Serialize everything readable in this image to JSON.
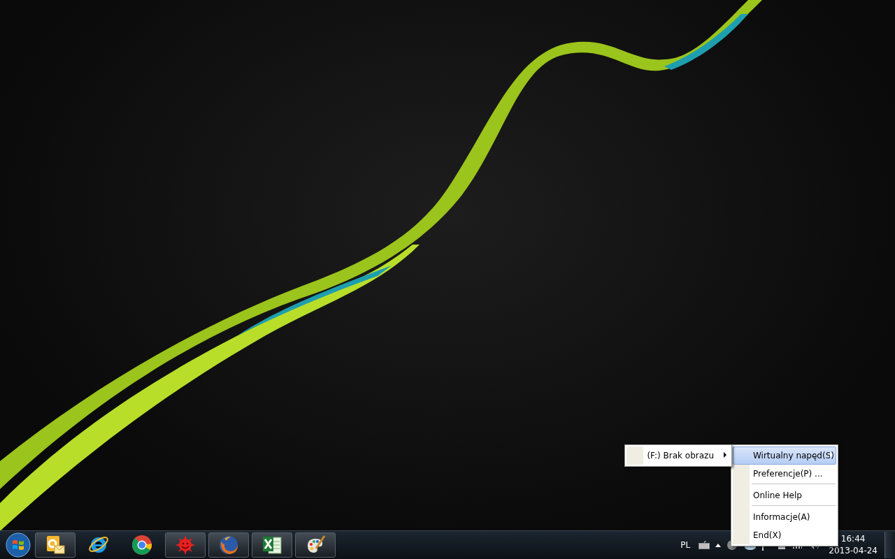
{
  "context_menu": {
    "items": [
      {
        "label": "Wirtualny napęd(S)",
        "selected": true,
        "submenu": true,
        "separator_after": false
      },
      {
        "label": "Preferencje(P) ...",
        "selected": false,
        "submenu": false,
        "separator_after": true
      },
      {
        "label": "Online Help",
        "selected": false,
        "submenu": false,
        "separator_after": true
      },
      {
        "label": "Informacje(A)",
        "selected": false,
        "submenu": false,
        "separator_after": false
      },
      {
        "label": "End(X)",
        "selected": false,
        "submenu": false,
        "separator_after": false
      }
    ]
  },
  "submenu": {
    "items": [
      {
        "label": "(F:) Brak obrazu",
        "selected": false,
        "submenu": true,
        "separator_after": false
      }
    ]
  },
  "taskbar": {
    "apps": [
      {
        "kind": "outlook",
        "running": true
      },
      {
        "kind": "ie",
        "running": false
      },
      {
        "kind": "chrome",
        "running": false
      },
      {
        "kind": "sun",
        "running": true
      },
      {
        "kind": "firefox",
        "running": true
      },
      {
        "kind": "excel",
        "running": true
      },
      {
        "kind": "paint",
        "running": true
      }
    ],
    "language": "PL",
    "time": "16:44",
    "date": "2013-04-24"
  }
}
